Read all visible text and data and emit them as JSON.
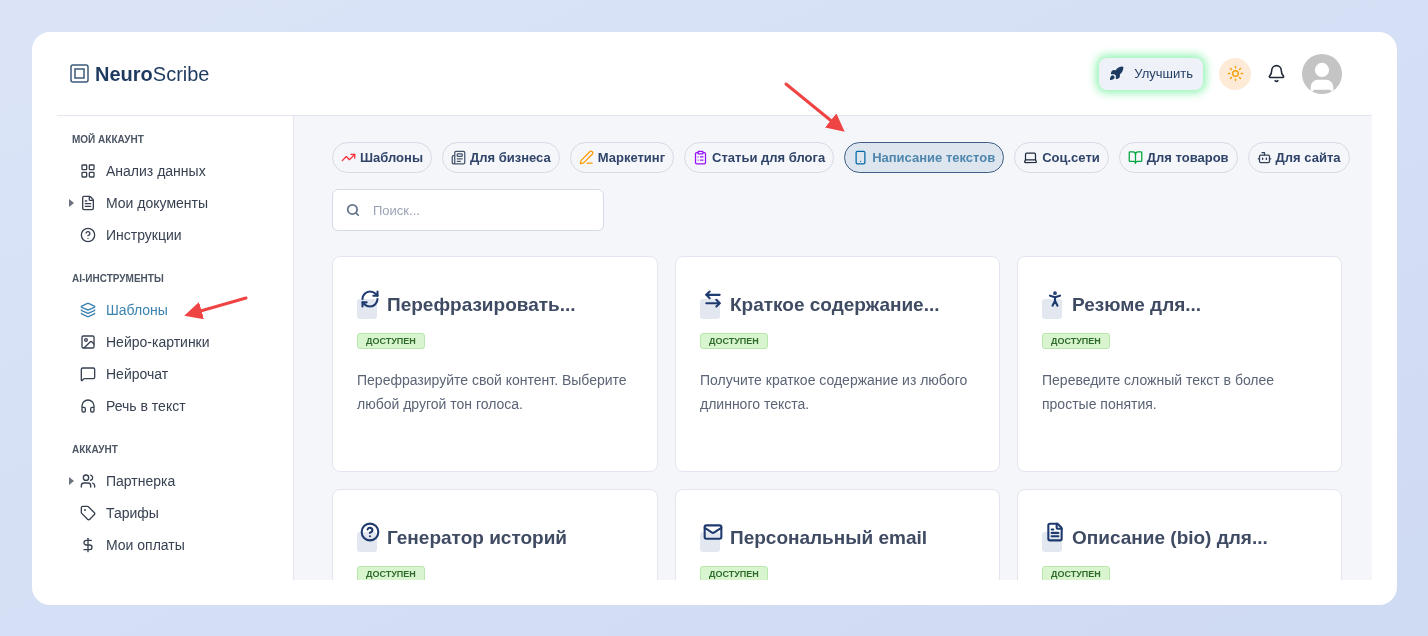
{
  "logo": {
    "bold": "Neuro",
    "rest": "Scribe"
  },
  "header": {
    "upgrade_button": "Улучшить"
  },
  "sidebar": {
    "sections": [
      {
        "title": "МОЙ АККАУНТ",
        "items": [
          {
            "label": "Анализ данных",
            "expandable": false,
            "selected": false
          },
          {
            "label": "Мои документы",
            "expandable": true,
            "selected": false
          },
          {
            "label": "Инструкции",
            "expandable": false,
            "selected": false
          }
        ]
      },
      {
        "title": "AI-ИНСТРУМЕНТЫ",
        "items": [
          {
            "label": "Шаблоны",
            "expandable": false,
            "selected": true
          },
          {
            "label": "Нейро-картинки",
            "expandable": false,
            "selected": false
          },
          {
            "label": "Нейрочат",
            "expandable": false,
            "selected": false
          },
          {
            "label": "Речь в текст",
            "expandable": false,
            "selected": false
          }
        ]
      },
      {
        "title": "АККАУНТ",
        "items": [
          {
            "label": "Партнерка",
            "expandable": true,
            "selected": false
          },
          {
            "label": "Тарифы",
            "expandable": false,
            "selected": false
          },
          {
            "label": "Мои оплаты",
            "expandable": false,
            "selected": false
          }
        ]
      }
    ]
  },
  "categories": [
    {
      "label": "Шаблоны",
      "selected": false
    },
    {
      "label": "Для бизнеса",
      "selected": false
    },
    {
      "label": "Маркетинг",
      "selected": false
    },
    {
      "label": "Статьи для блога",
      "selected": false
    },
    {
      "label": "Написание текстов",
      "selected": true
    },
    {
      "label": "Соц.сети",
      "selected": false
    },
    {
      "label": "Для товаров",
      "selected": false
    },
    {
      "label": "Для сайта",
      "selected": false
    }
  ],
  "search": {
    "placeholder": "Поиск..."
  },
  "cards": [
    {
      "title": "Перефразировать...",
      "badge": "ДОСТУПЕН",
      "description": "Перефразируйте свой контент. Выберите любой другой тон голоса."
    },
    {
      "title": "Краткое содержание...",
      "badge": "ДОСТУПЕН",
      "description": "Получите краткое содержание из любого длинного текста."
    },
    {
      "title": "Резюме для...",
      "badge": "ДОСТУПЕН",
      "description": "Переведите сложный текст в более простые понятия."
    },
    {
      "title": "Генератор историй",
      "badge": "ДОСТУПЕН"
    },
    {
      "title": "Персональный email",
      "badge": "ДОСТУПЕН"
    },
    {
      "title": "Описание (bio) для...",
      "badge": "ДОСТУПЕН"
    }
  ]
}
